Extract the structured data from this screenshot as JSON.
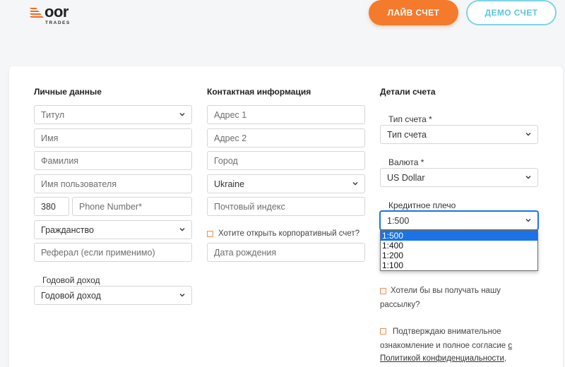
{
  "header": {
    "logo_word_rest": "oor",
    "logo_sub": "TRADES",
    "live_button": "ЛАЙВ СЧЕТ",
    "demo_button": "ДЕМО СЧЕТ"
  },
  "personal": {
    "title": "Личные данные",
    "title_field": "Титул",
    "first_name": "Имя",
    "last_name": "Фамилия",
    "username": "Имя пользователя",
    "phone_code": "380",
    "phone_placeholder": "Phone Number*",
    "citizenship": "Гражданство",
    "referral": "Реферал (если применимо)",
    "income_label": "Годовой доход",
    "income_select": "Годовой доход"
  },
  "contact": {
    "title": "Контактная информация",
    "address1": "Адрес 1",
    "address2": "Адрес 2",
    "city": "Город",
    "country": "Ukraine",
    "postcode": "Почтовый индекс",
    "corporate_question": "Хотите открыть корпоративный счет?",
    "birthdate": "Дата рождения"
  },
  "account": {
    "title": "Детали счета",
    "type_label": "Тип счета *",
    "type_select": "Тип счета",
    "currency_label": "Валюта *",
    "currency_select": "US Dollar",
    "leverage_label": "Кредитное плечо",
    "leverage_select": "1:500",
    "leverage_options": [
      "1:500",
      "1:400",
      "1:200",
      "1:100"
    ],
    "newsletter_line1": "Хотели бы вы получать нашу",
    "newsletter_line2": "рассылку?",
    "consent_line1": "Подтверждаю внимательное",
    "consent_line2_pre": "ознакомление и полное согласие",
    "consent_line2_link": "с",
    "consent_line3_link": "Политикой конфиденциальности",
    "consent_line3_post": ","
  },
  "colors": {
    "accent": "#f47a2c",
    "demo": "#59c6e0",
    "select_highlight": "#1a73e8"
  },
  "icons": {
    "chevron": "chevron-down-icon"
  }
}
